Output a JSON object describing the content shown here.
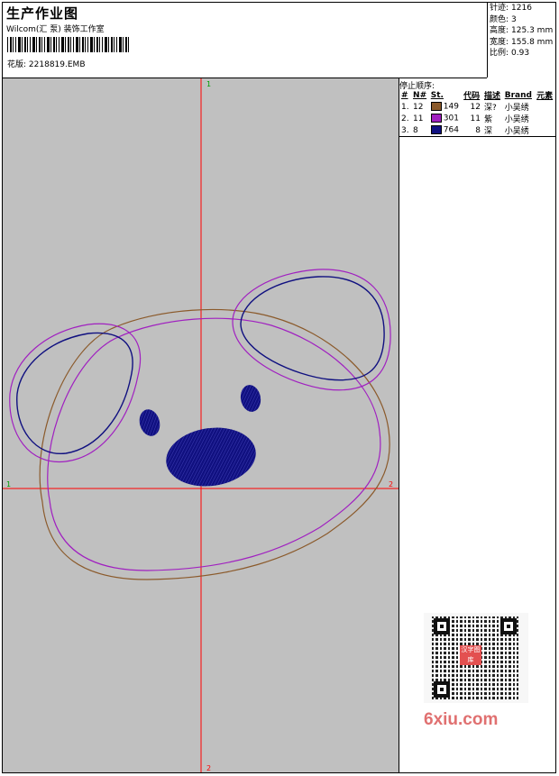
{
  "header": {
    "title": "生产作业图",
    "subtitle": "Wilcom(汇 泵) 装饰工作室",
    "design_label": "花版:",
    "design_name": "2218819.EMB"
  },
  "stats": [
    {
      "label": "针迹:",
      "value": "1216"
    },
    {
      "label": "颜色:",
      "value": "3"
    },
    {
      "label": "高度:",
      "value": "125.3 mm"
    },
    {
      "label": "宽度:",
      "value": "155.8 mm"
    },
    {
      "label": "比例:",
      "value": "0.93"
    }
  ],
  "sequence": {
    "title": "停止顺序:",
    "columns": [
      "#",
      "N#",
      "St.",
      "代码",
      "描述",
      "Brand",
      "元素"
    ],
    "rows": [
      {
        "index": "1.",
        "n": "12",
        "color": "#8b5a2b",
        "st": "149",
        "code": "12",
        "desc": "深?",
        "brand": "小吴绣"
      },
      {
        "index": "2.",
        "n": "11",
        "color": "#a020c0",
        "st": "301",
        "code": "11",
        "desc": "紫",
        "brand": "小吴绣"
      },
      {
        "index": "3.",
        "n": "8",
        "color": "#101080",
        "st": "764",
        "code": "8",
        "desc": "深",
        "brand": "小吴绣"
      }
    ]
  },
  "axis_markers": {
    "top": "1",
    "left": "1",
    "right": "2",
    "bottom": "2"
  },
  "colors": {
    "canvas": "#c0c0c0",
    "crosshair": "#ff0000",
    "brown": "#8b5a2b",
    "purple": "#a020c0",
    "navy": "#101080"
  },
  "qr_logo_text": "汉字图库",
  "watermark": "6xiu.com"
}
